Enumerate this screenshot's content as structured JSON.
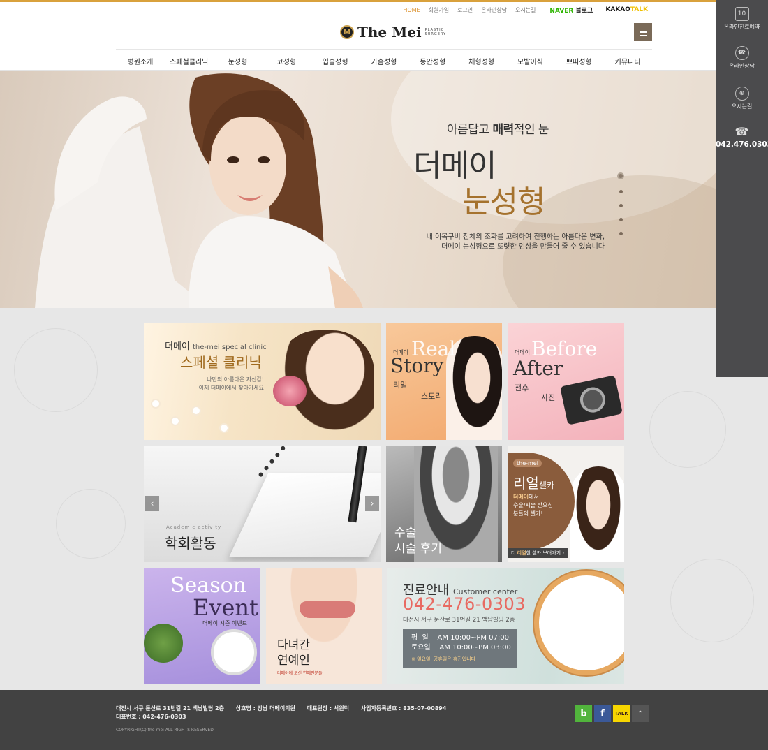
{
  "util": {
    "home": "HOME",
    "join": "회원가입",
    "login": "로그인",
    "consult": "온라인상담",
    "location": "오시는길",
    "naver_a": "NAVER",
    "naver_b": "블로그",
    "kakao_a": "KAKAO",
    "kakao_b": "TALK"
  },
  "logo": {
    "mark": "M",
    "name": "The Mei",
    "sub1": "PLASTIC",
    "sub2": "SURGERY"
  },
  "gnb": [
    "병원소개",
    "스페셜클리닉",
    "눈성형",
    "코성형",
    "입술성형",
    "가슴성형",
    "동안성형",
    "체형성형",
    "모발이식",
    "쁘띠성형",
    "커뮤니티"
  ],
  "hero": {
    "sub_a": "아름답고 ",
    "sub_b": "매력",
    "sub_c": "적인 눈",
    "title1": "더메이",
    "title2": "눈성형",
    "desc1": "내 이목구비 전체의 조화를 고려하여 진행하는 아름다운 변화,",
    "desc2": "더메이 눈성형으로 또렷한 인상을 만들어 줄 수 있습니다"
  },
  "quick": {
    "reserve_icon": "10",
    "reserve": "온라인진료예약",
    "consult": "온라인상담",
    "location": "오시는길",
    "phone": "042.476.0303"
  },
  "tiles": {
    "special": {
      "a": "더메이 ",
      "a2": "the-mei special clinic",
      "b": "스페셜 클리닉",
      "c1": "나만의 아름다운 자신감!",
      "c2": "이제 더메이에서 찾아가세요"
    },
    "story": {
      "label": "더메이",
      "r1": "Real",
      "r2": "Story",
      "r3": "리얼",
      "r4": "스토리"
    },
    "ba": {
      "label": "더메이",
      "r1": "Before",
      "r2": "After",
      "r3": "전후",
      "r4": "사진"
    },
    "academic": {
      "s": "Academic activity",
      "m": "학회활동",
      "prev": "‹",
      "next": "›"
    },
    "review": {
      "m1": "수술",
      "m2": "시술 후기"
    },
    "selfie": {
      "tag": "the-mei",
      "h1": "리얼",
      "h2": "셀카",
      "p1a": "더메이",
      "p1b": "에서",
      "p2": "수술/시술 받으신",
      "p3": "분들의 셀카!",
      "bar_a": "더 ",
      "bar_b": "리얼",
      "bar_c": "한 셀카 보러가기 ›"
    },
    "season": {
      "s1": "Season",
      "s2": "Event",
      "s3": "더메이 시즌 이벤트"
    },
    "celeb": {
      "m1": "다녀간",
      "m2": "연예인",
      "m3": "더메이에 오신 연예인분들!"
    },
    "center": {
      "h1": "진료안내 ",
      "h1b": "Customer center",
      "phone": "042-476-0303",
      "addr": "대전시 서구 둔산로 31번길 21 백남빌딩 2층",
      "weekday": "평  일    AM 10:00~PM 07:00",
      "saturday": "토요일    AM 10:00~PM 03:00",
      "note": "※ 일요일, 공휴일은 휴진입니다"
    }
  },
  "footer": {
    "address": "대전시 서구 둔산로 31번길 21 백남빌딩 2층",
    "company": "상호명 : 강남 더메이의원",
    "ceo": "대표원장 : 서원덕",
    "bizno": "사업자등록번호 : 835-07-00894",
    "tel": "대표번호 : 042-476-0303",
    "copyright": "COPYRIGHT(C) the-mei ALL RIGHTS RESERVED",
    "blog": "b",
    "fb": "f",
    "kakao": "TALK",
    "top": "⌃"
  }
}
